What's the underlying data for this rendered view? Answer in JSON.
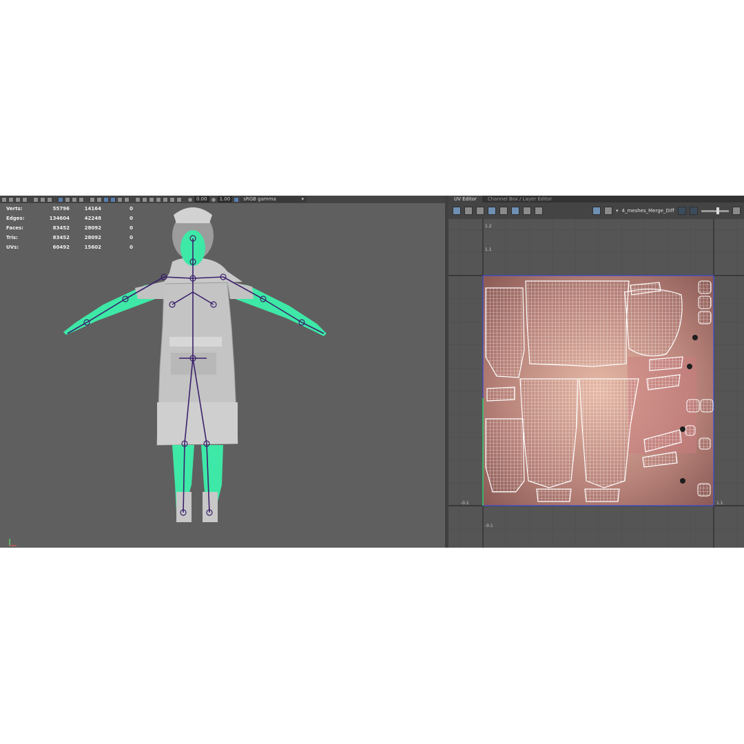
{
  "viewport": {
    "toolbar": {
      "exposure": "0.00",
      "gamma": "1.00",
      "color_space": "sRGB gamma"
    },
    "hud": [
      {
        "label": "Verts:",
        "total": "55796",
        "selected": "14164",
        "extra": "0"
      },
      {
        "label": "Edges:",
        "total": "134604",
        "selected": "42248",
        "extra": "0"
      },
      {
        "label": "Faces:",
        "total": "83452",
        "selected": "28092",
        "extra": "0"
      },
      {
        "label": "Tris:",
        "total": "83452",
        "selected": "28092",
        "extra": "0"
      },
      {
        "label": "UVs:",
        "total": "60492",
        "selected": "15602",
        "extra": "0"
      }
    ],
    "axis_labels": {
      "x": "x",
      "y": "y"
    }
  },
  "uv_editor": {
    "tabs": [
      "UV Editor",
      "Channel Box / Layer Editor"
    ],
    "texture_name": "4_meshes_Merge_Diff",
    "axis_labels": {
      "u_top": "1.2",
      "u_mid": "1.1",
      "v_left": "-0.1",
      "v_bottom": "-0.1",
      "v_right": "1.1"
    }
  },
  "colors": {
    "viewport_bg": "#5f5f5f",
    "skin_weight": "#3ee8a6",
    "joint": "#3a1f6b",
    "uv_wire": "#ffffff",
    "uv_frame": "#3b4bd6"
  }
}
